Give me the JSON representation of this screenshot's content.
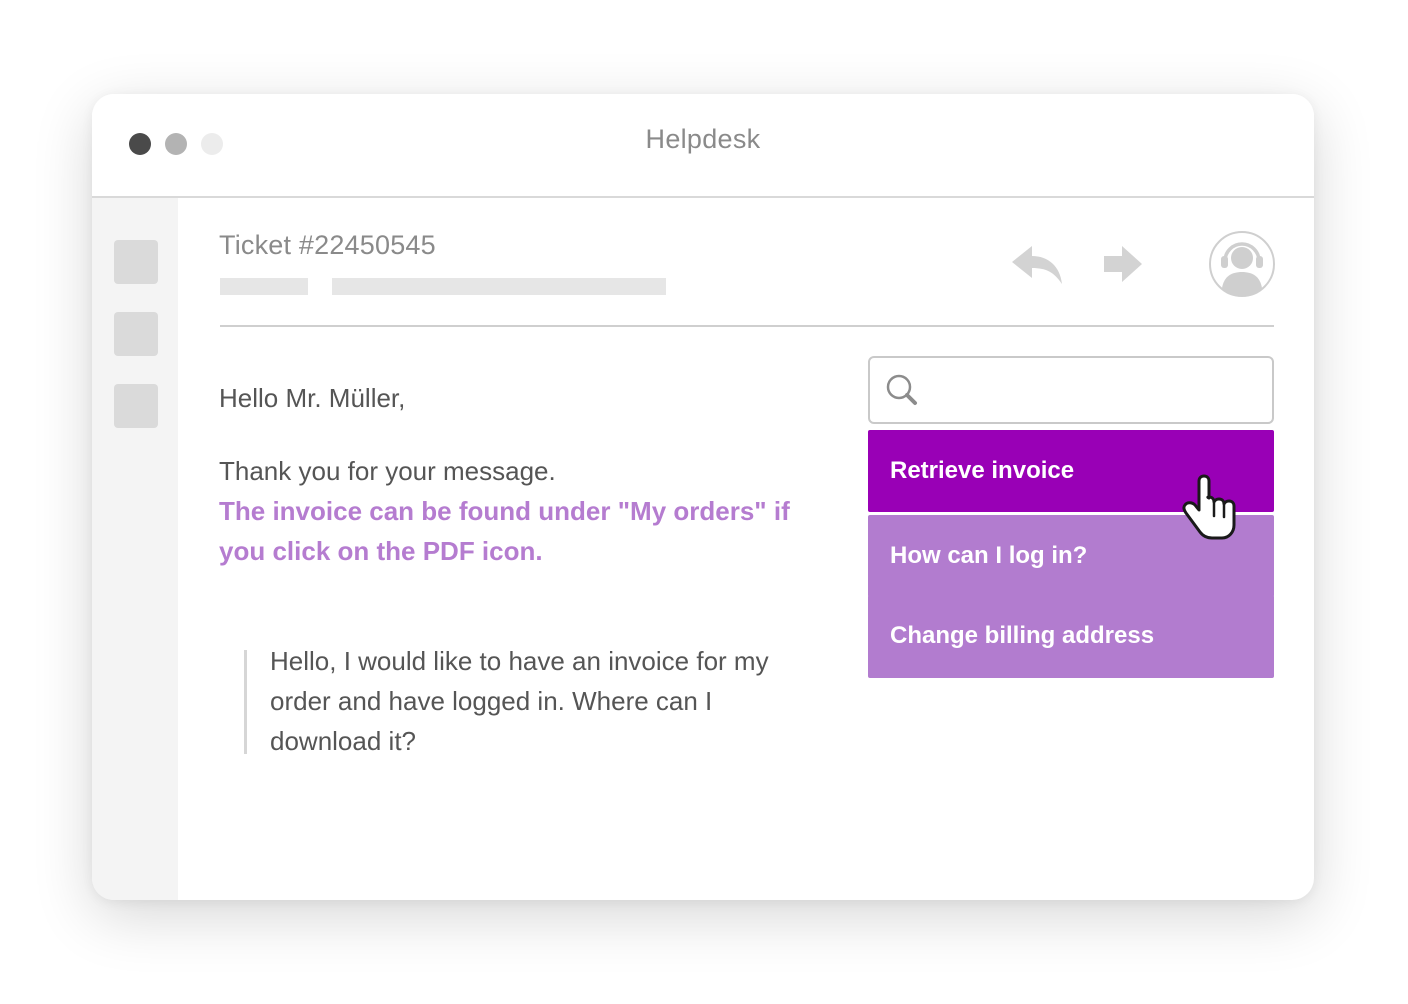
{
  "window": {
    "title": "Helpdesk",
    "traffic_lights": [
      "dark-dot",
      "gray-dot",
      "light-dot"
    ]
  },
  "sidebar": {
    "items": [
      "sidebar-button",
      "sidebar-button",
      "sidebar-button"
    ]
  },
  "ticket": {
    "title": "Ticket #22450545",
    "actions": [
      "reply-icon",
      "forward-icon",
      "support-agent-avatar-icon"
    ]
  },
  "message": {
    "greeting": "Hello Mr. Müller,",
    "thanks": "Thank you for your message.",
    "highlight": "The invoice can be found under \"My orders\" if you click on the PDF icon.",
    "quote": "Hello, I would like to have an invoice for my order and have logged in. Where can I download it?"
  },
  "search": {
    "placeholder": "",
    "value": "",
    "icon": "search-icon"
  },
  "suggestions": [
    {
      "label": "Retrieve invoice",
      "active": true
    },
    {
      "label": "How can I log in?",
      "active": false
    },
    {
      "label": "Change billing address",
      "active": false
    }
  ],
  "colors": {
    "accent_active": "#9900b6",
    "accent": "#b27ccf",
    "highlight_text": "#b57cd0",
    "muted_text": "#8a8a8a",
    "body_text": "#555555"
  }
}
